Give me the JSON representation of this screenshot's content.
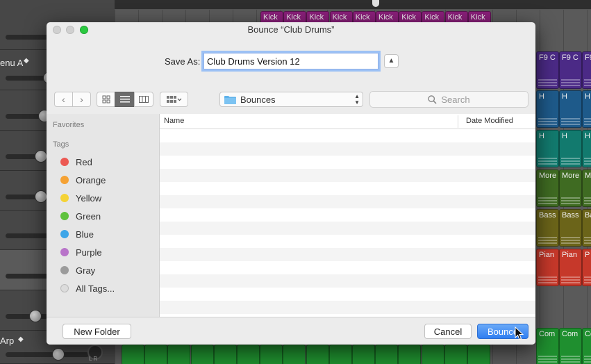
{
  "daw": {
    "tracks": [
      {
        "label": ""
      },
      {
        "label": "enu A"
      },
      {
        "label": ""
      },
      {
        "label": ""
      },
      {
        "label": ""
      },
      {
        "label": ""
      },
      {
        "label": ""
      },
      {
        "label": ""
      },
      {
        "label": "Arp"
      }
    ],
    "regions": {
      "kick": "Kick",
      "f9": "F9 C",
      "h": "H",
      "more": "More",
      "more_short": "M",
      "bass": "Bass",
      "pian": "Pian",
      "pian_short": "P",
      "com": "Com",
      "pan_marks": "L   R"
    },
    "colors": {
      "kick": "#8a1f7a",
      "f9": "#4b2a86",
      "h_blue": "#1e5a8a",
      "h_teal": "#127a6e",
      "more": "#3f6b22",
      "bass": "#6b6419",
      "pian": "#c6382a",
      "com": "#1f8f2f"
    }
  },
  "dialog": {
    "title": "Bounce “Club Drums”",
    "save_as_label": "Save As:",
    "save_as_value": "Club Drums Version 12",
    "toolbar": {
      "back_glyph": "‹",
      "forward_glyph": "›",
      "location": "Bounces",
      "search_placeholder": "Search"
    },
    "sidebar": {
      "favorites_heading": "Favorites",
      "tags_heading": "Tags",
      "tags": [
        {
          "label": "Red",
          "color": "#ec5953"
        },
        {
          "label": "Orange",
          "color": "#f5a234"
        },
        {
          "label": "Yellow",
          "color": "#f5d336"
        },
        {
          "label": "Green",
          "color": "#5fc23d"
        },
        {
          "label": "Blue",
          "color": "#3ea6e8"
        },
        {
          "label": "Purple",
          "color": "#b874c9"
        },
        {
          "label": "Gray",
          "color": "#9b9b9b"
        },
        {
          "label": "All Tags...",
          "color": "#dcdcdc"
        }
      ]
    },
    "file_list": {
      "columns": {
        "name": "Name",
        "date_modified": "Date Modified"
      }
    },
    "footer": {
      "new_folder": "New Folder",
      "cancel": "Cancel",
      "bounce": "Bounce"
    }
  }
}
